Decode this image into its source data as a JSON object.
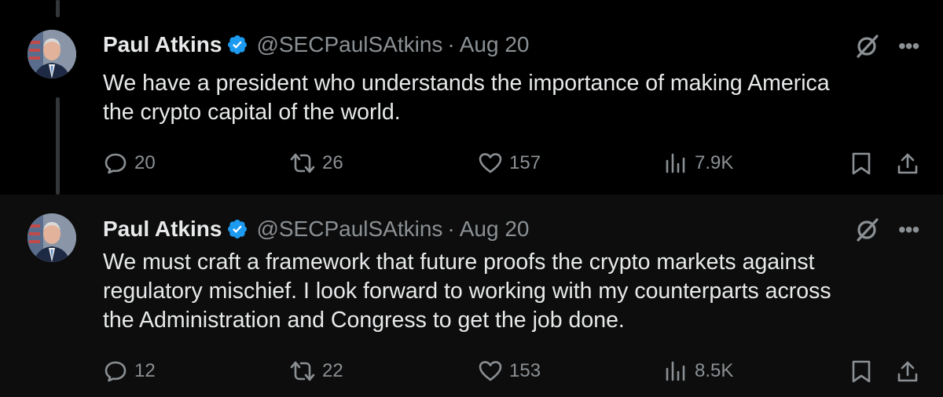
{
  "tweets": [
    {
      "author_name": "Paul Atkins",
      "handle": "@SECPaulSAtkins",
      "separator": "·",
      "date": "Aug 20",
      "text_lines": [
        "We have a president who understands the importance of making America",
        "the crypto capital of the world."
      ],
      "replies": "20",
      "reposts": "26",
      "likes": "157",
      "views": "7.9K"
    },
    {
      "author_name": "Paul Atkins",
      "handle": "@SECPaulSAtkins",
      "separator": "·",
      "date": "Aug 20",
      "text_lines": [
        "We must craft a framework that future proofs the crypto markets against",
        "regulatory mischief. I look forward to working with my counterparts across",
        "the Administration and Congress to get the job done."
      ],
      "replies": "12",
      "reposts": "22",
      "likes": "153",
      "views": "8.5K"
    }
  ],
  "icons": {
    "verified": "verified-badge-icon",
    "grok": "grok-icon",
    "more": "more-icon",
    "reply": "reply-icon",
    "repost": "repost-icon",
    "like": "heart-icon",
    "views": "views-icon",
    "bookmark": "bookmark-icon",
    "share": "share-icon"
  },
  "colors": {
    "background": "#000000",
    "text": "#e7e9ea",
    "secondary": "#8b9094",
    "verified_badge": "#1d9bf0"
  }
}
